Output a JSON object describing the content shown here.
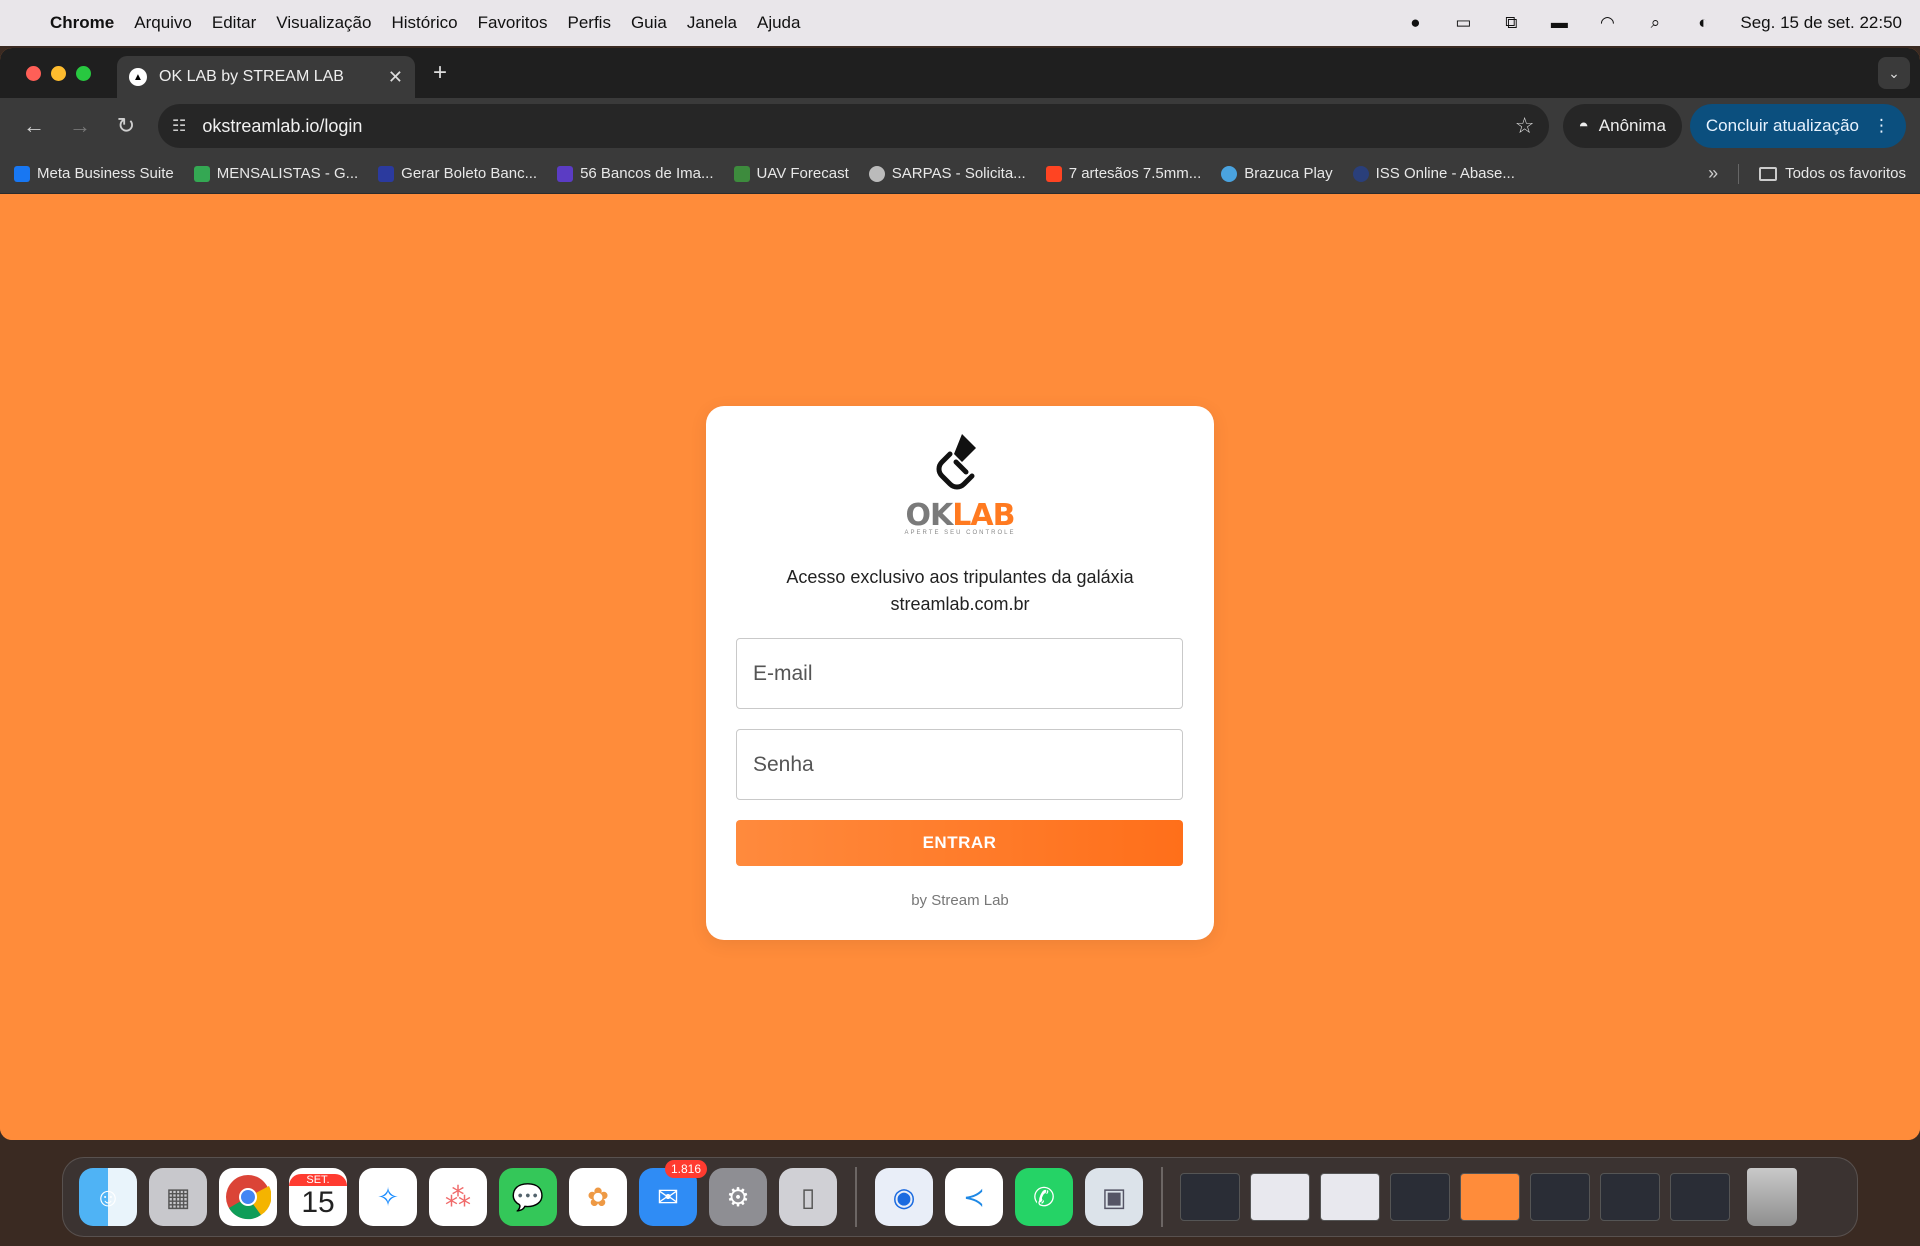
{
  "menubar": {
    "app_name": "Chrome",
    "items": [
      "Arquivo",
      "Editar",
      "Visualização",
      "Histórico",
      "Favoritos",
      "Perfis",
      "Guia",
      "Janela",
      "Ajuda"
    ],
    "datetime": "Seg. 15 de set.  22:50"
  },
  "browser": {
    "tab_title": "OK LAB by STREAM LAB",
    "url": "okstreamlab.io/login",
    "incognito_label": "Anônima",
    "update_label": "Concluir atualização",
    "bookmarks": [
      {
        "label": "Meta Business Suite",
        "color": "#1877f2"
      },
      {
        "label": "MENSALISTAS - G...",
        "color": "#34a853"
      },
      {
        "label": "Gerar Boleto Banc...",
        "color": "#2b3a9e"
      },
      {
        "label": "56 Bancos de Ima...",
        "color": "#5b3cc4"
      },
      {
        "label": "UAV Forecast",
        "color": "#3d8b3d"
      },
      {
        "label": "SARPAS - Solicita...",
        "color": "#bbbbbb"
      },
      {
        "label": "7 artesãos 7.5mm...",
        "color": "#ff4422"
      },
      {
        "label": "Brazuca Play",
        "color": "#4aa3df"
      },
      {
        "label": "ISS Online - Abase...",
        "color": "#2a3f7a"
      }
    ],
    "all_bookmarks_label": "Todos os favoritos"
  },
  "login": {
    "logo_ok": "OK",
    "logo_lab": "LAB",
    "logo_tagline": "APERTE SEU CONTROLE",
    "subtitle_line1": "Acesso exclusivo aos tripulantes da galáxia",
    "subtitle_line2": "streamlab.com.br",
    "email_placeholder": "E-mail",
    "password_placeholder": "Senha",
    "submit_label": "ENTRAR",
    "byline": "by Stream Lab"
  },
  "dock": {
    "mail_badge": "1.816",
    "calendar_month": "SET.",
    "calendar_day": "15"
  },
  "colors": {
    "page_bg": "#ff8c3a",
    "accent": "#ff7a20"
  }
}
